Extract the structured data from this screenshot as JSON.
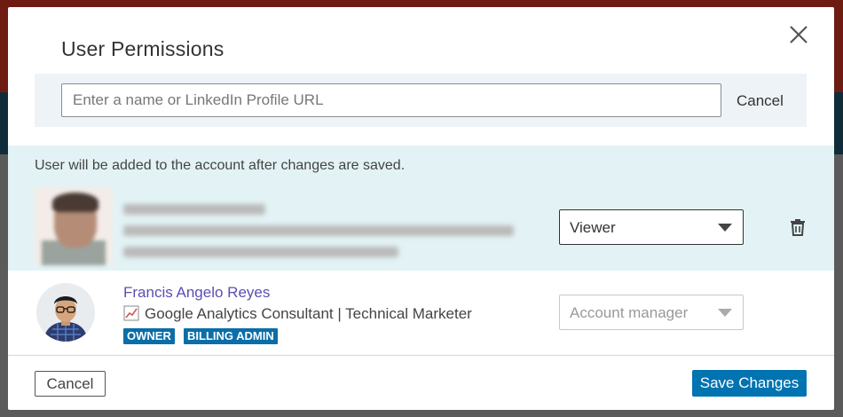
{
  "dialog": {
    "title": "User Permissions",
    "search": {
      "placeholder": "Enter a name or LinkedIn Profile URL",
      "value": "",
      "cancel_label": "Cancel"
    },
    "notice": "User will be added to the account after changes are saved."
  },
  "pending_user": {
    "role": "Viewer"
  },
  "existing_user": {
    "name": "Francis Angelo Reyes",
    "headline": "Google Analytics Consultant | Technical Marketer",
    "badges": [
      "OWNER",
      "BILLING ADMIN"
    ],
    "role": "Account manager"
  },
  "footer": {
    "cancel_label": "Cancel",
    "save_label": "Save Changes"
  },
  "colors": {
    "primary": "#0073b1",
    "link": "#5a4fb2",
    "badge": "#0a6ea8",
    "notice_bg": "#e3f3f5"
  },
  "icons": [
    "close-icon",
    "trash-icon",
    "chevron-down-icon",
    "trending-icon"
  ]
}
